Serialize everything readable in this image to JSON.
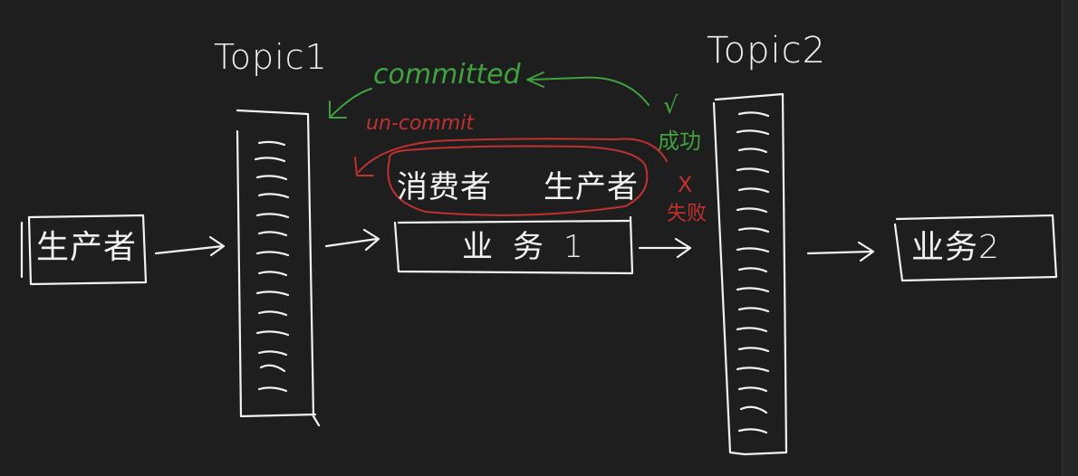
{
  "labels": {
    "producer_left": "生产者",
    "topic1": "Topic1",
    "topic2": "Topic2",
    "consumer": "消费者",
    "producer_mid": "生产者",
    "business1": "业务1",
    "business2": "业务2",
    "committed": "committed",
    "un_commit": "un-commit",
    "check_mark": "√",
    "success": "成功",
    "x_mark": "X",
    "failure": "失败"
  },
  "colors": {
    "background": "#1e1e1e",
    "ink": "#f2f2f2",
    "success_green": "#3fa23f",
    "failure_red": "#c0312f"
  }
}
